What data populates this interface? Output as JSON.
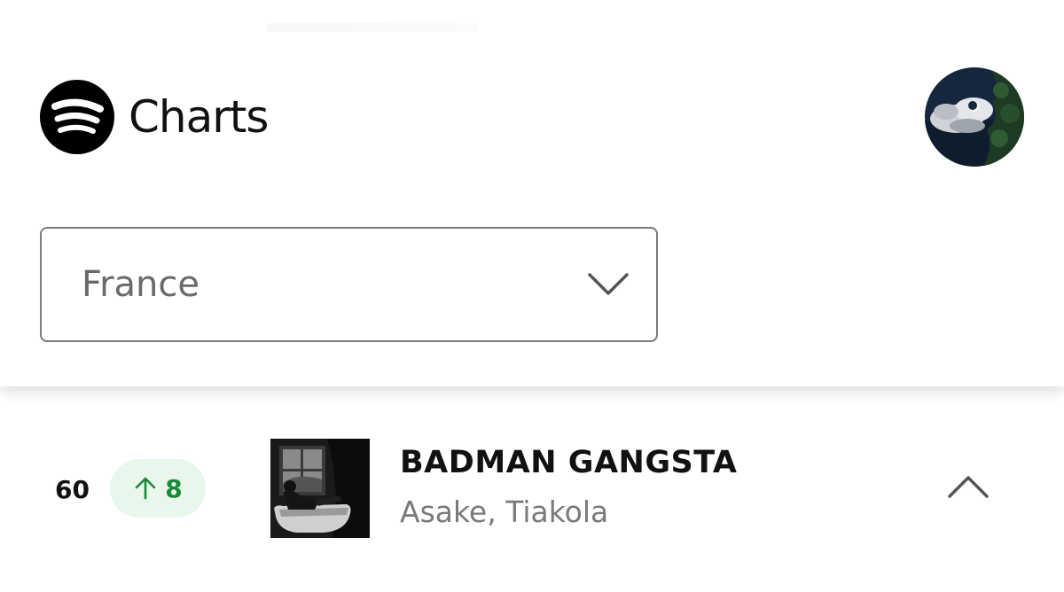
{
  "header": {
    "title": "Charts",
    "logo_icon": "spotify-logo-icon",
    "avatar_icon": "avatar-night-sky-clouds"
  },
  "filter": {
    "country_value": "France",
    "dropdown_icon": "chevron-down-icon"
  },
  "chart_rows": [
    {
      "rank": "60",
      "movement": {
        "direction": "up",
        "value": "8",
        "icon": "arrow-up-icon",
        "color": "#1a8a3a",
        "background": "#e9f6ec"
      },
      "title": "BADMAN GANGSTA",
      "artists": "Asake, Tiakola",
      "cover_icon": "album-cover-art",
      "expand_icon": "chevron-up-icon"
    }
  ],
  "colors": {
    "text_primary": "#111111",
    "text_secondary": "#7a7a7a",
    "border": "#7c7c7c",
    "accent_green": "#1a8a3a"
  }
}
